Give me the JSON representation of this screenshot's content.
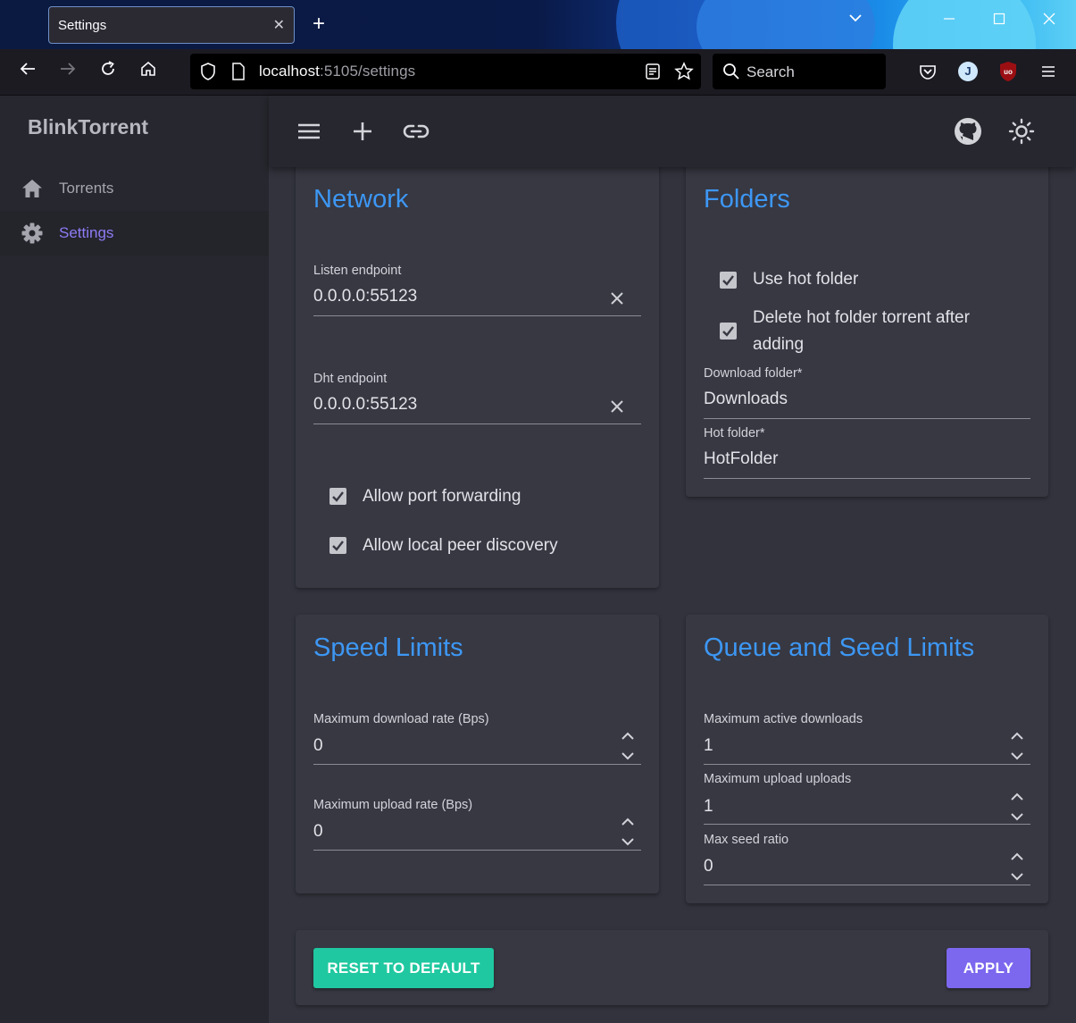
{
  "browser": {
    "tab_title": "Settings",
    "url_host": "localhost",
    "url_rest": ":5105/settings",
    "search_placeholder": "Search",
    "profile_initial": "J"
  },
  "app": {
    "brand": "BlinkTorrent",
    "nav": [
      {
        "label": "Torrents",
        "icon": "home-icon",
        "active": false
      },
      {
        "label": "Settings",
        "icon": "gear-icon",
        "active": true
      }
    ],
    "toolbar": {
      "menu_icon": "menu-icon",
      "add_icon": "plus-icon",
      "link_icon": "link-icon",
      "github_icon": "github-icon",
      "theme_icon": "sun-icon"
    }
  },
  "network": {
    "title": "Network",
    "listen_label": "Listen endpoint",
    "listen_value": "0.0.0.0:55123",
    "dht_label": "Dht endpoint",
    "dht_value": "0.0.0.0:55123",
    "port_forwarding_label": "Allow port forwarding",
    "port_forwarding_checked": true,
    "local_peer_label": "Allow local peer discovery",
    "local_peer_checked": true
  },
  "folders": {
    "title": "Folders",
    "use_hot_folder_label": "Use hot folder",
    "use_hot_folder_checked": true,
    "delete_hot_label_1": "Delete hot folder torrent after",
    "delete_hot_label_2": "adding",
    "delete_hot_checked": true,
    "download_label": "Download folder*",
    "download_value": "Downloads",
    "hot_label": "Hot folder*",
    "hot_value": "HotFolder"
  },
  "speed": {
    "title": "Speed Limits",
    "download_label": "Maximum download rate (Bps)",
    "download_value": "0",
    "upload_label": "Maximum upload rate (Bps)",
    "upload_value": "0"
  },
  "queue": {
    "title": "Queue and Seed Limits",
    "active_downloads_label": "Maximum active downloads",
    "active_downloads_value": "1",
    "upload_uploads_label": "Maximum upload uploads",
    "upload_uploads_value": "1",
    "seed_ratio_label": "Max seed ratio",
    "seed_ratio_value": "0"
  },
  "actions": {
    "reset_label": "RESET TO DEFAULT",
    "apply_label": "APPLY",
    "reset_color": "#1fc8a0",
    "apply_color": "#7b68ee"
  }
}
